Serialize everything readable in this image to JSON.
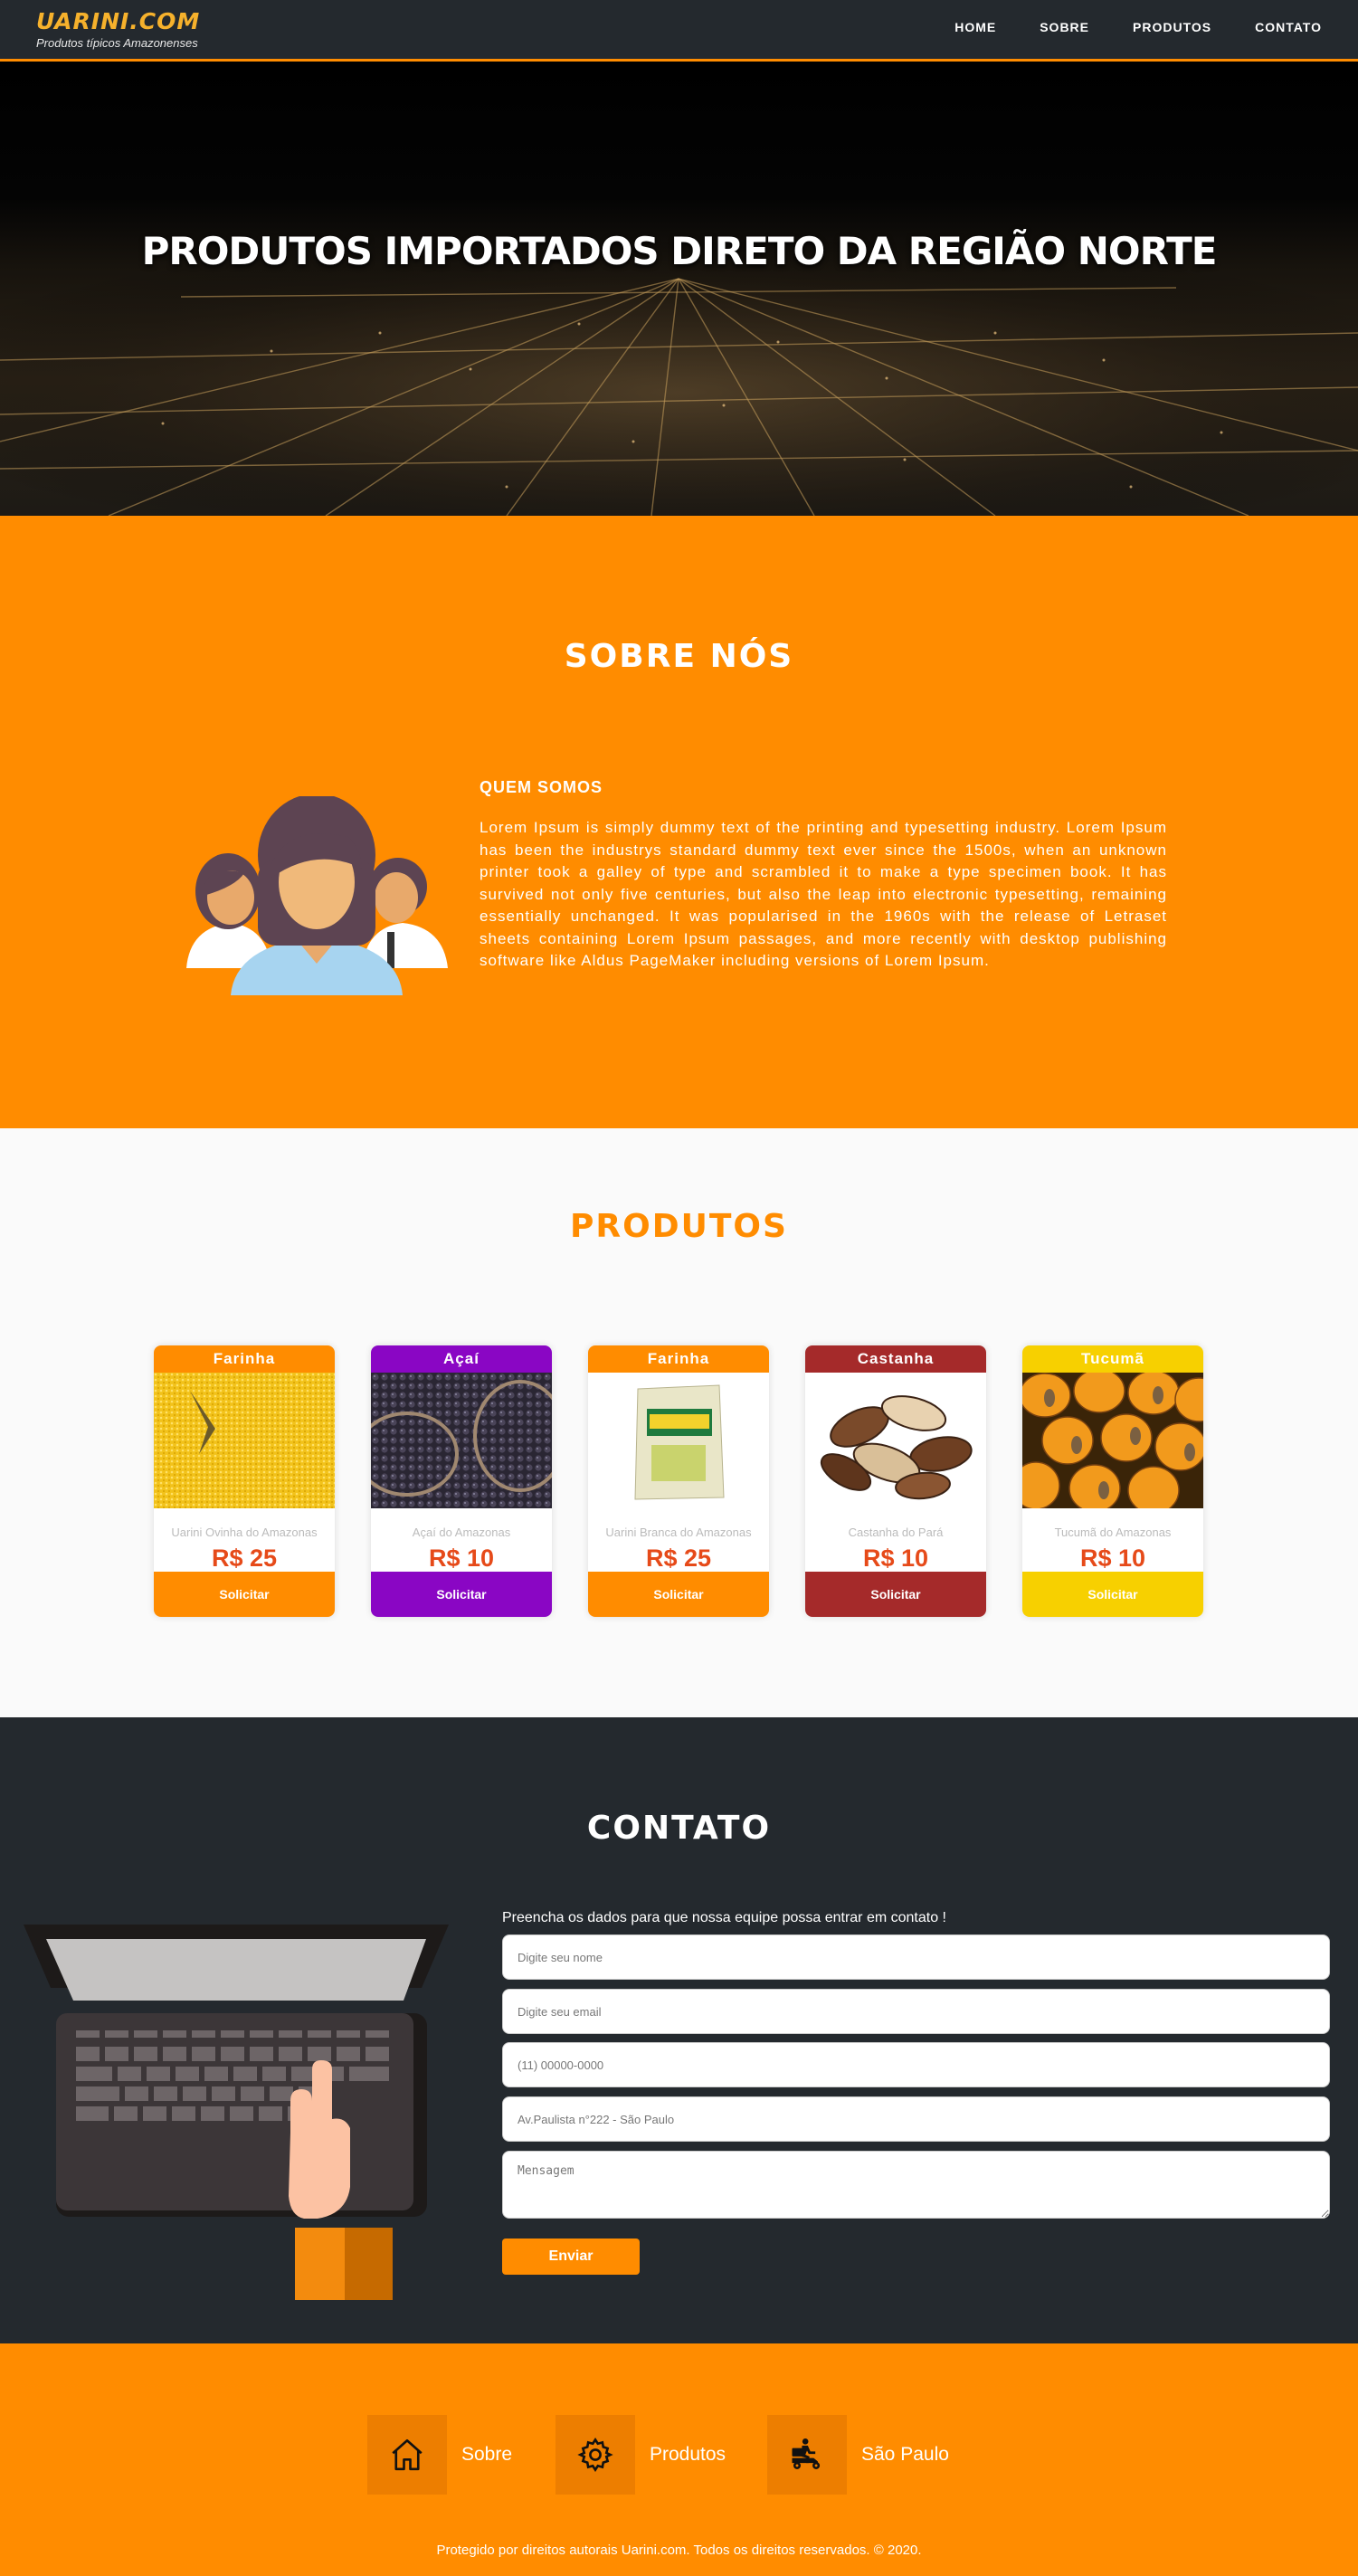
{
  "navbar": {
    "brand": "UARINI.COM",
    "tagline": "Produtos típicos Amazonenses",
    "links": [
      "HOME",
      "SOBRE",
      "PRODUTOS",
      "CONTATO"
    ]
  },
  "hero": {
    "title": "PRODUTOS IMPORTADOS DIRETO DA REGIÃO NORTE"
  },
  "sobre": {
    "title": "SOBRE NÓS",
    "subtitle": "QUEM SOMOS",
    "text": "Lorem Ipsum is simply dummy text of the printing and typesetting industry. Lorem Ipsum has been the industrys standard dummy text ever since the 1500s, when an unknown printer took a galley of type and scrambled it to make a type specimen book. It has survived not only five centuries, but also the leap into electronic typesetting, remaining essentially unchanged. It was popularised in the 1960s with the release of Letraset sheets containing Lorem Ipsum passages, and more recently with desktop publishing software like Aldus PageMaker including versions of Lorem Ipsum."
  },
  "produtos": {
    "title": "PRODUTOS",
    "items": [
      {
        "category": "Farinha",
        "name": "Uarini Ovinha do Amazonas",
        "price": "R$ 25",
        "button": "Solicitar",
        "color": "#ff8c00"
      },
      {
        "category": "Açaí",
        "name": "Açaí do Amazonas",
        "price": "R$ 10",
        "button": "Solicitar",
        "color": "#8a06c4"
      },
      {
        "category": "Farinha",
        "name": "Uarini Branca do Amazonas",
        "price": "R$ 25",
        "button": "Solicitar",
        "color": "#ff8c00"
      },
      {
        "category": "Castanha",
        "name": "Castanha do Pará",
        "price": "R$ 10",
        "button": "Solicitar",
        "color": "#a52a2a"
      },
      {
        "category": "Tucumã",
        "name": "Tucumã do Amazonas",
        "price": "R$ 10",
        "button": "Solicitar",
        "color": "#f7d000"
      }
    ]
  },
  "contato": {
    "title": "CONTATO",
    "intro": "Preencha os dados para que nossa equipe possa entrar em contato !",
    "fields": {
      "nome": "Digite seu nome",
      "email": "Digite seu email",
      "telefone": "(11) 00000-0000",
      "endereco": "Av.Paulista n°222 - São Paulo",
      "mensagem": "Mensagem"
    },
    "submit": "Enviar"
  },
  "footer": {
    "items": [
      {
        "label": "Sobre",
        "icon": "home-icon"
      },
      {
        "label": "Produtos",
        "icon": "gear-icon"
      },
      {
        "label": "São Paulo",
        "icon": "delivery-scooter-icon"
      }
    ],
    "copyright": "Protegido por direitos autorais Uarini.com. Todos os direitos reservados. © 2020."
  }
}
